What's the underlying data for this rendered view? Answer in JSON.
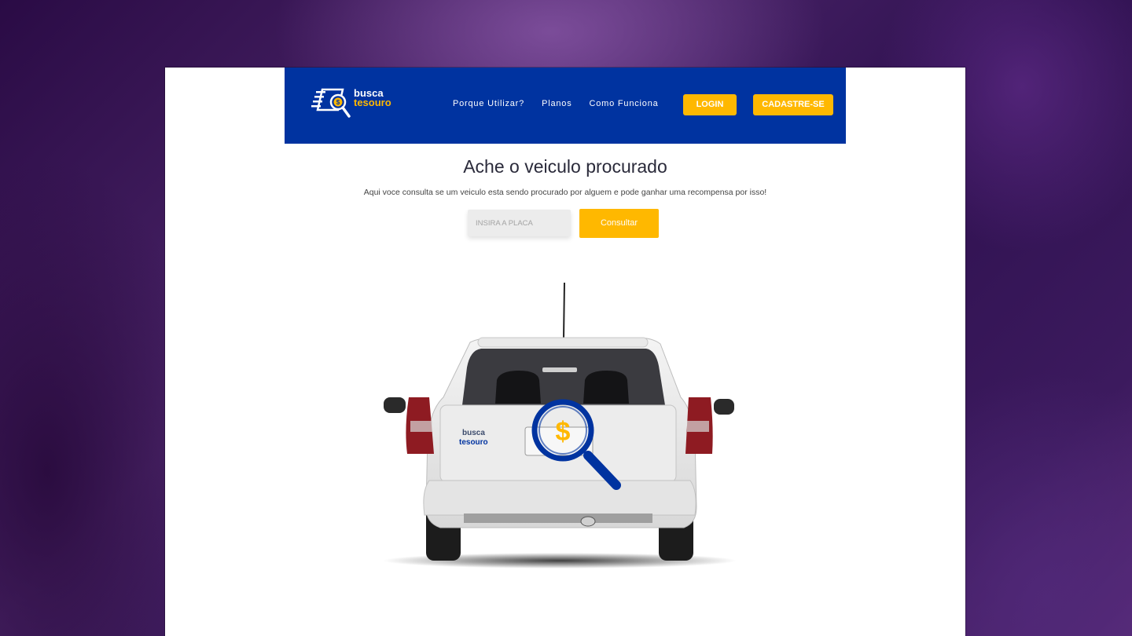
{
  "header": {
    "logo": {
      "line1": "busca",
      "line2": "tesouro"
    },
    "nav": [
      "Porque Utilizar?",
      "Planos",
      "Como Funciona"
    ],
    "login_label": "LOGIN",
    "signup_label": "CADASTRE-SE"
  },
  "hero": {
    "title": "Ache o veiculo procurado",
    "subtitle": "Aqui voce consulta se um veiculo esta sendo procurado por alguem e pode ganhar uma recompensa por isso!",
    "plate_placeholder": "INSIRA A PLACA",
    "consult_label": "Consultar"
  },
  "car_illustration": {
    "badge_line1": "busca",
    "badge_line2": "tesouro",
    "symbol": "$"
  },
  "colors": {
    "brand_blue": "#0033a0",
    "accent_yellow": "#ffb800"
  }
}
